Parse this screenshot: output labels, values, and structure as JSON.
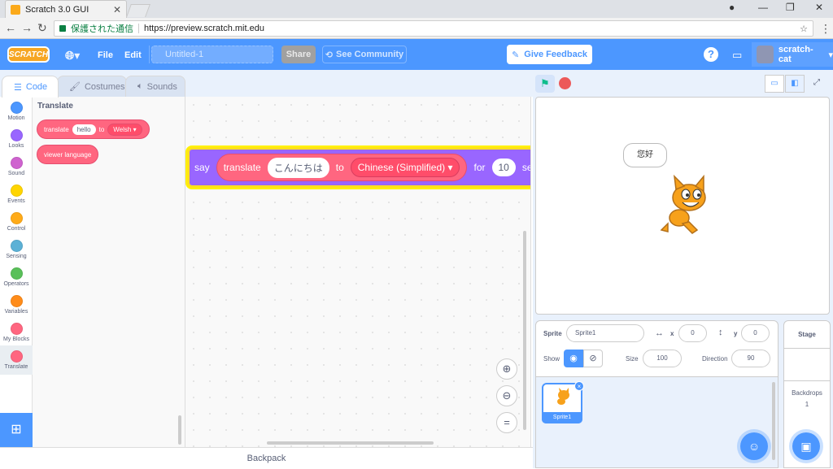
{
  "browser": {
    "tab_title": "Scratch 3.0 GUI",
    "security_label": "保護された通信",
    "url": "https://preview.scratch.mit.edu"
  },
  "menubar": {
    "logo_text": "SCRATCH",
    "file": "File",
    "edit": "Edit",
    "project_title": "Untitled-1",
    "share": "Share",
    "see_community": "See Community",
    "give_feedback": "Give Feedback",
    "username": "scratch-cat"
  },
  "editor_tabs": [
    {
      "label": "Code"
    },
    {
      "label": "Costumes"
    },
    {
      "label": "Sounds"
    }
  ],
  "categories": [
    {
      "label": "Motion",
      "color": "#4c97ff"
    },
    {
      "label": "Looks",
      "color": "#9966ff"
    },
    {
      "label": "Sound",
      "color": "#cf63cf"
    },
    {
      "label": "Events",
      "color": "#ffd500"
    },
    {
      "label": "Control",
      "color": "#ffab19"
    },
    {
      "label": "Sensing",
      "color": "#5cb1d6"
    },
    {
      "label": "Operators",
      "color": "#59c059"
    },
    {
      "label": "Variables",
      "color": "#ff8c1a"
    },
    {
      "label": "My Blocks",
      "color": "#ff6680"
    },
    {
      "label": "Translate",
      "color": "#ff6680"
    }
  ],
  "flyout": {
    "title": "Translate",
    "translate_block": {
      "prefix": "translate",
      "text": "hello",
      "to": "to",
      "language": "Welsh"
    },
    "viewer_language_block": "viewer language"
  },
  "workspace": {
    "say_block": {
      "say": "say",
      "translate": "translate",
      "text": "こんにちは",
      "to": "to",
      "language": "Chinese (Simplified)",
      "for": "for",
      "seconds_value": "10",
      "seconds_label": "secon"
    }
  },
  "backpack_label": "Backpack",
  "stage": {
    "speech_bubble": "您好"
  },
  "sprite_info": {
    "sprite_label": "Sprite",
    "sprite_name": "Sprite1",
    "x_label": "x",
    "x_value": "0",
    "y_label": "y",
    "y_value": "0",
    "show_label": "Show",
    "size_label": "Size",
    "size_value": "100",
    "direction_label": "Direction",
    "direction_value": "90"
  },
  "sprite_list": [
    {
      "name": "Sprite1"
    }
  ],
  "stage_panel": {
    "header": "Stage",
    "backdrops_label": "Backdrops",
    "backdrops_count": "1"
  },
  "colors": {
    "accent": "#4c97ff",
    "translate_block": "#ff6680",
    "looks_block": "#9966ff",
    "highlight": "#ffe11a"
  }
}
